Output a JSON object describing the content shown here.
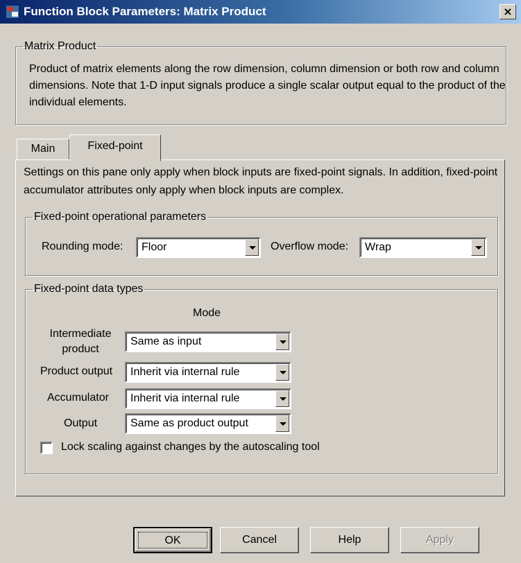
{
  "window": {
    "title": "Function Block Parameters: Matrix Product",
    "close_label": "×"
  },
  "block": {
    "group_title": "Matrix Product",
    "description": "Product of matrix elements along the row dimension, column dimension or both row and column dimensions. Note that 1-D input signals produce a single scalar output equal to the product of the individual elements."
  },
  "tabs": [
    {
      "label": "Main",
      "selected": false
    },
    {
      "label": "Fixed-point",
      "selected": true
    }
  ],
  "fixed_point": {
    "pane_description": "Settings on this pane only apply when block inputs are fixed-point signals. In addition, fixed-point accumulator attributes only apply when block inputs are complex.",
    "operational": {
      "group_title": "Fixed-point operational parameters",
      "rounding_label": "Rounding mode:",
      "rounding_value": "Floor",
      "overflow_label": "Overflow mode:",
      "overflow_value": "Wrap"
    },
    "data_types": {
      "group_title": "Fixed-point data types",
      "mode_header": "Mode",
      "rows": [
        {
          "label_line1": "Intermediate",
          "label_line2": "product",
          "value": "Same as input"
        },
        {
          "label": "Product output",
          "value": "Inherit via internal rule"
        },
        {
          "label": "Accumulator",
          "value": "Inherit via internal rule"
        },
        {
          "label": "Output",
          "value": "Same as product output"
        }
      ],
      "lock_scaling_label": "Lock scaling against changes by the autoscaling tool",
      "lock_scaling_checked": false
    }
  },
  "buttons": {
    "ok": "OK",
    "cancel": "Cancel",
    "help": "Help",
    "apply": "Apply"
  },
  "icons": {
    "app": "simulink-block-icon",
    "close": "close-icon",
    "dropdown": "chevron-down-icon"
  }
}
